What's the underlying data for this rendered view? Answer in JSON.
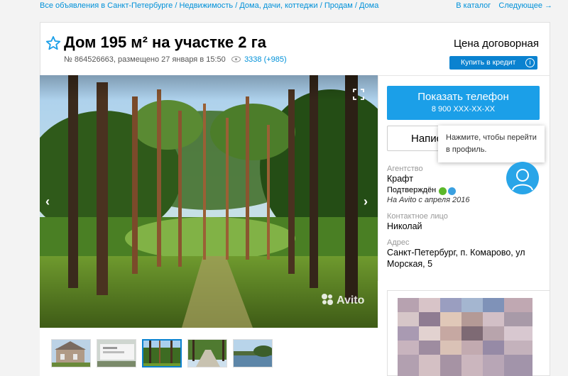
{
  "breadcrumbs": {
    "text": "Все объявления в Санкт-Петербурге / Недвижимость / Дома, дачи, коттеджи / Продам / Дома"
  },
  "nav": {
    "catalog": "В каталог",
    "next": "Следующее →"
  },
  "listing": {
    "title": "Дом 195 м² на участке 2 га",
    "meta": "№ 864526663, размещено 27 января в 15:50",
    "views": "3338 (+985)",
    "price": "Цена договорная",
    "credit_button": "Купить в кредит",
    "credit_info": "i"
  },
  "gallery": {
    "prev": "‹",
    "next": "›",
    "watermark": "Avito",
    "thumbs": [
      "house",
      "sign",
      "forest",
      "road",
      "lake"
    ],
    "active_thumb": 2
  },
  "contact": {
    "phone_button": "Показать телефон",
    "phone_number": "8 900 XXX-XX-XX",
    "write_button": "Написать",
    "tooltip": "Нажмите, чтобы перейти в профиль.",
    "tooltip_line1": "Нажмите, чтобы перейти",
    "tooltip_line2": "в профиль.",
    "agency_label": "Агентство",
    "agency_name": "Крафт",
    "verified": "Подтверждён",
    "since": "На Avito с апреля 2016",
    "contact_label": "Контактное лицо",
    "contact_name": "Николай",
    "address_label": "Адрес",
    "address_line1": "Санкт-Петербург, п. Комарово, ул",
    "address_line2": "Морская, 5"
  },
  "colors": {
    "link": "#0091d9",
    "primary_button": "#1b9fe8",
    "credit_button": "#0a82d0"
  },
  "icons": [
    "star-icon",
    "eye-icon",
    "fullscreen-icon",
    "chevron-left-icon",
    "chevron-right-icon",
    "info-icon",
    "phone-verified-icon",
    "email-verified-icon",
    "user-avatar-icon"
  ]
}
